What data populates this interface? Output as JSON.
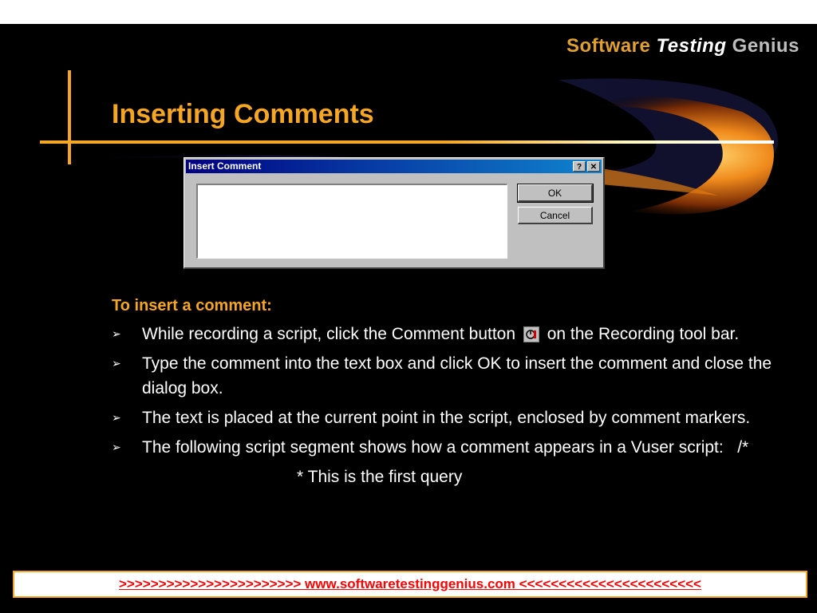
{
  "logo": {
    "word1": "Software",
    "word2": "Testing",
    "word3": "Genius"
  },
  "slide": {
    "title": "Inserting Comments"
  },
  "dialog": {
    "title": "Insert Comment",
    "help_button": "?",
    "close_button": "✕",
    "text_value": "",
    "ok_label": "OK",
    "cancel_label": "Cancel"
  },
  "content": {
    "intro": "To insert a comment:",
    "bullet_glyph": "➢",
    "bullets": [
      {
        "before": "While recording a script, click the Comment button",
        "after": "on the Recording tool bar."
      },
      {
        "text": "Type the comment into the text box and click OK to insert the comment and close the dialog box."
      },
      {
        "text": "The text is placed at the current point in the script, enclosed by comment markers."
      },
      {
        "text": "The following script segment shows how a comment appears in a Vuser script:   /*"
      }
    ],
    "query_line": "* This is the first query"
  },
  "footer": {
    "text": ">>>>>>>>>>>>>>>>>>>>>>>  www.softwaretestinggenius.com  <<<<<<<<<<<<<<<<<<<<<<<"
  },
  "colors": {
    "accent": "#f5a623",
    "footer_link": "#ff0000",
    "titlebar": "#000080"
  }
}
